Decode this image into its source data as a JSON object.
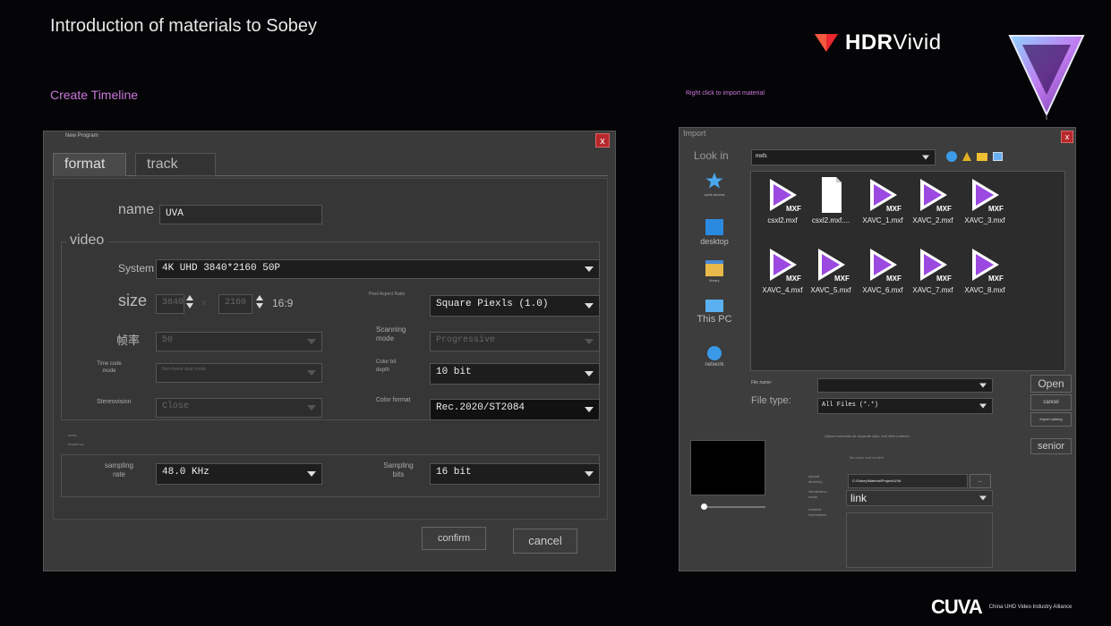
{
  "slide": {
    "title": "Introduction of materials to Sobey",
    "brand_hdr": "HDR",
    "brand_vivid": "Vivid",
    "section_left": "Create Timeline",
    "section_right": "Right click to import material",
    "footer_mark": "CUVA",
    "footer_text": "China UHD Video Industry Alliance"
  },
  "new_program": {
    "title": "New Program",
    "close": "x",
    "tabs": [
      "format",
      "track"
    ],
    "name_label": "name",
    "name_value": "UVA",
    "video_group": "video",
    "system_label": "System",
    "system_value": "4K UHD 3840*2160 50P",
    "size_label": "size",
    "width_value": "3840",
    "separator": "x",
    "height_value": "2160",
    "aspect": "16:9",
    "pixel_aspect_label": "Pixel Aspect Ratio",
    "pixel_aspect_value": "Square Piexls (1.0)",
    "frame_rate_label": "帧率",
    "frame_rate_value": "50",
    "scanning_label_1": "Scanning",
    "scanning_label_2": "mode",
    "scanning_value": "Progressive",
    "timecode_label_1": "Time code",
    "timecode_label_2": "mode",
    "timecode_value": "Non-frame drop mode",
    "color_bit_label_1": "Color bit",
    "color_bit_label_2": "depth",
    "color_bit_value": "10 bit",
    "stereo_label": "Stereovision",
    "stereo_value": "Close",
    "color_format_label": "Color format",
    "color_format_value": "Rec.2020/ST2084",
    "audio_group": "audio",
    "frequency_label": "frequency",
    "sampling_rate_label_1": "sampling",
    "sampling_rate_label_2": "rate",
    "sampling_rate_value": "48.0 KHz",
    "sampling_bits_label_1": "Sampling",
    "sampling_bits_label_2": "bits",
    "sampling_bits_value": "16 bit",
    "confirm": "confirm",
    "cancel": "cancel"
  },
  "import": {
    "title": "Import",
    "close": "x",
    "look_in_label": "Look in",
    "look_in_value": "mxfs",
    "places": [
      "quick access",
      "desktop",
      "library",
      "This PC",
      "network"
    ],
    "files": [
      {
        "name": "csxl2.mxf",
        "kind": "mxf"
      },
      {
        "name": "csxl2.mxf....",
        "kind": "doc"
      },
      {
        "name": "XAVC_1.mxf",
        "kind": "mxf"
      },
      {
        "name": "XAVC_2.mxf",
        "kind": "mxf"
      },
      {
        "name": "XAVC_3.mxf",
        "kind": "mxf"
      },
      {
        "name": "XAVC_4.mxf",
        "kind": "mxf"
      },
      {
        "name": "XAVC_5.mxf",
        "kind": "mxf"
      },
      {
        "name": "XAVC_6.mxf",
        "kind": "mxf"
      },
      {
        "name": "XAVC_7.mxf",
        "kind": "mxf"
      },
      {
        "name": "XAVC_8.mxf",
        "kind": "mxf"
      }
    ],
    "mxf_badge": "MXF",
    "file_name_label": "File name:",
    "file_name_value": "",
    "file_type_label": "File type:",
    "file_type_value": "All Files (*.*)",
    "open": "Open",
    "cancel": "cancel",
    "import_catalog": "import catalog",
    "senior": "senior",
    "note": "Upload materials as separate clips, and after material",
    "note2": "file name and content",
    "upload_dir_label_1": "upload",
    "upload_dir_label_2": "directory",
    "upload_dir_value": "C:\\Sobey\\Material\\Project\\UVA",
    "browse": "...",
    "intro_mode_label_1": "introduction",
    "intro_mode_label_2": "mode",
    "intro_mode_value": "link",
    "material_info_label_1": "material",
    "material_info_label_2": "information"
  }
}
